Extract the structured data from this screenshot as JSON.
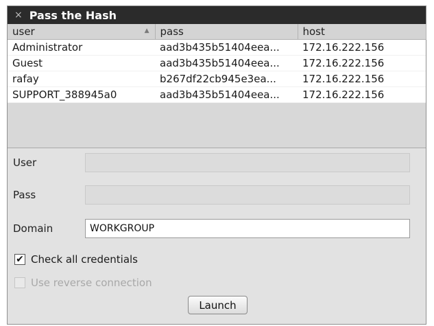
{
  "window": {
    "title": "Pass the Hash",
    "close_glyph": "×"
  },
  "table": {
    "columns": [
      "user",
      "pass",
      "host"
    ],
    "sort_glyph": "▲",
    "rows": [
      [
        "Administrator",
        "aad3b435b51404eea...",
        "172.16.222.156"
      ],
      [
        "Guest",
        "aad3b435b51404eea...",
        "172.16.222.156"
      ],
      [
        "rafay",
        "b267df22cb945e3ea...",
        "172.16.222.156"
      ],
      [
        "SUPPORT_388945a0",
        "aad3b435b51404eea...",
        "172.16.222.156"
      ]
    ]
  },
  "form": {
    "user_label": "User",
    "user_value": "",
    "pass_label": "Pass",
    "pass_value": "",
    "domain_label": "Domain",
    "domain_value": "WORKGROUP"
  },
  "options": {
    "check_all_label": "Check all credentials",
    "check_all_checked": true,
    "check_mark": "✔",
    "reverse_label": "Use reverse connection",
    "reverse_checked": false,
    "reverse_enabled": false
  },
  "launch_label": "Launch",
  "icons": {
    "close": "close-icon",
    "sort": "sort-ascending-icon",
    "check": "checkmark-icon"
  }
}
